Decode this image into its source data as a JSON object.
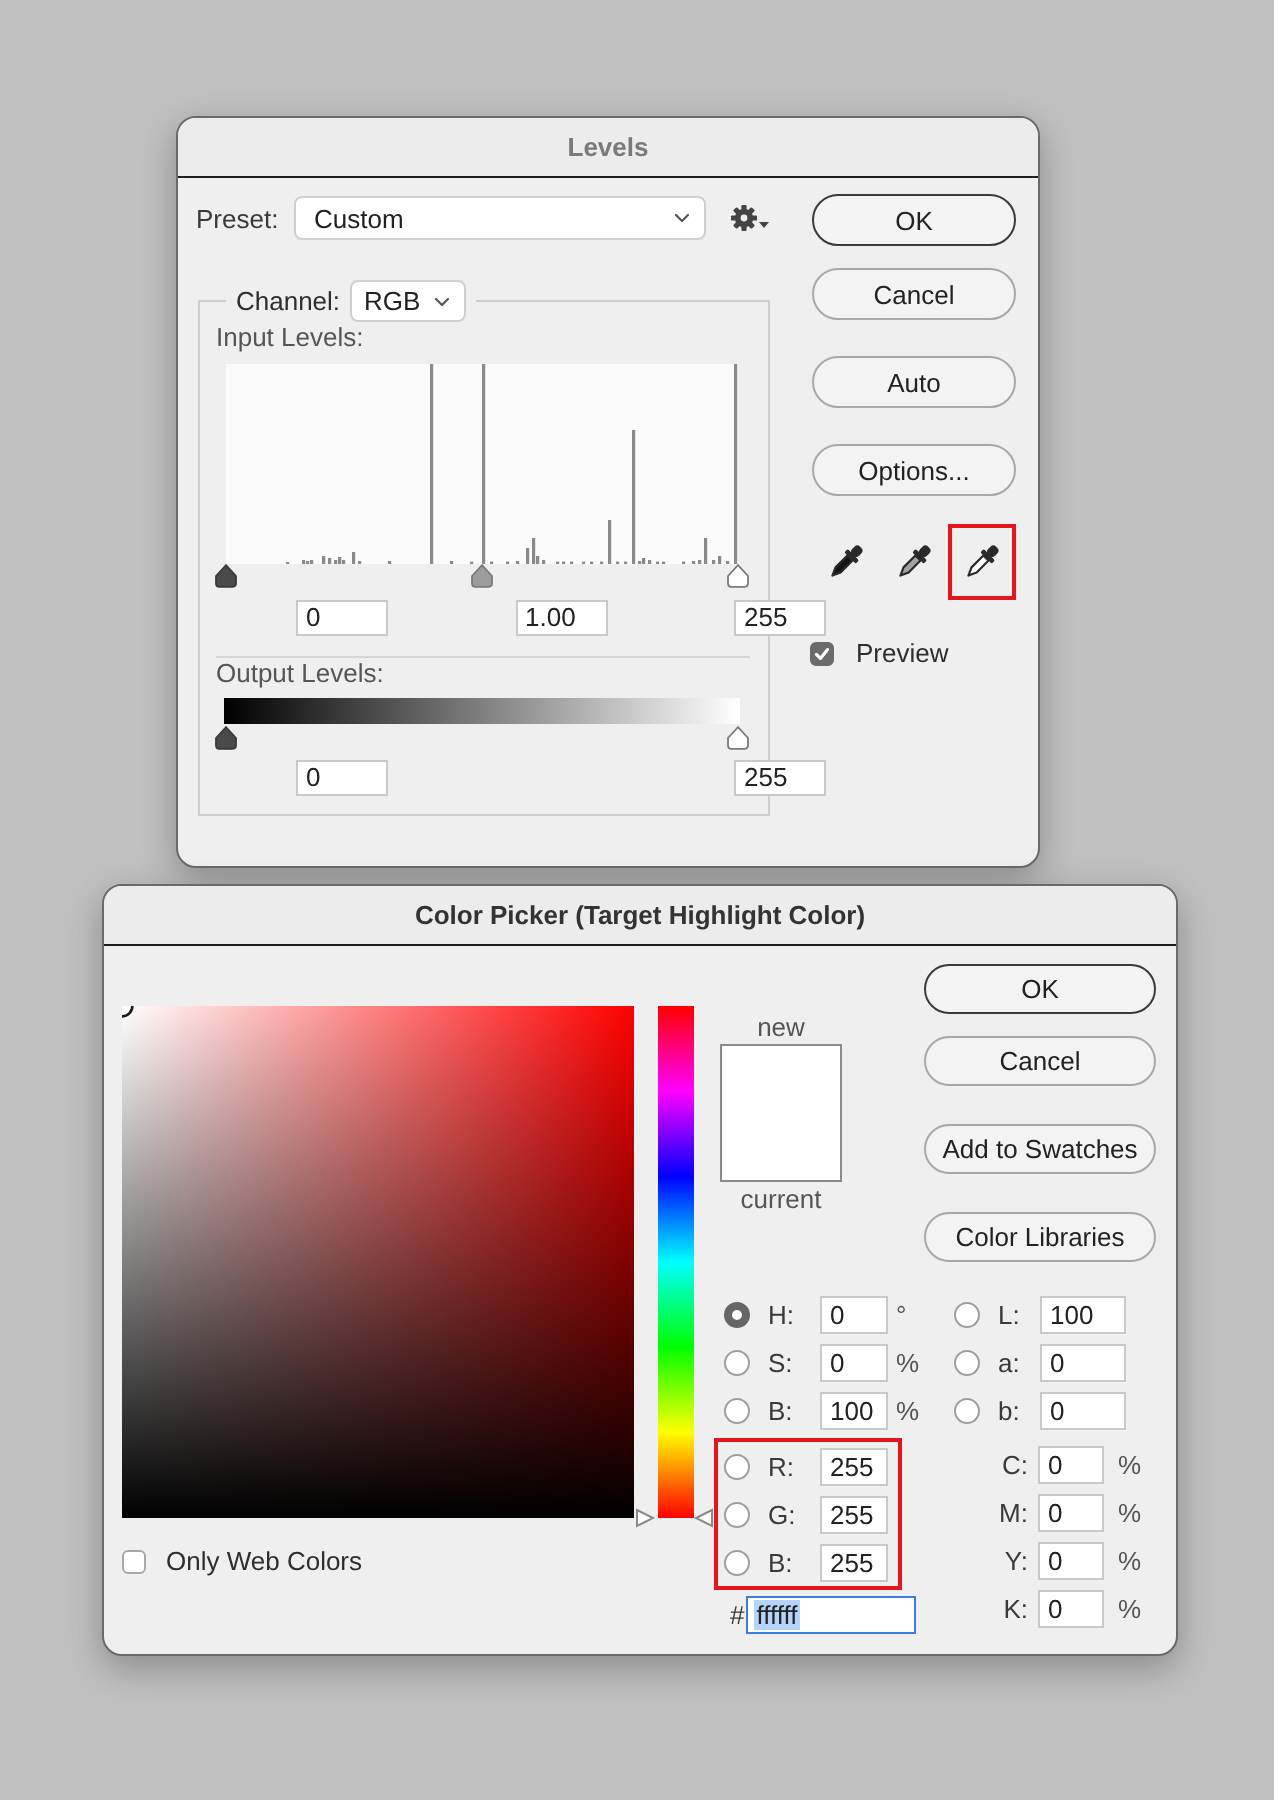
{
  "levels": {
    "title": "Levels",
    "active": false,
    "preset": {
      "label": "Preset:",
      "value": "Custom"
    },
    "channel": {
      "label": "Channel:",
      "value": "RGB"
    },
    "input_levels": {
      "label": "Input Levels:",
      "handles": [
        {
          "kind": "shadow",
          "level": 0
        },
        {
          "kind": "midtone",
          "level": 0.5
        },
        {
          "kind": "highlight",
          "level": 1
        }
      ],
      "fields": [
        "0",
        "1.00",
        "255"
      ]
    },
    "output_levels": {
      "label": "Output Levels:",
      "handles": [
        {
          "kind": "shadow",
          "level": 0
        },
        {
          "kind": "highlight",
          "level": 1
        }
      ],
      "fields": [
        "0",
        "255"
      ]
    },
    "buttons": [
      {
        "label": "OK",
        "default": true
      },
      {
        "label": "Cancel",
        "default": false
      },
      {
        "label": "Auto",
        "default": false
      },
      {
        "label": "Options...",
        "default": false
      }
    ],
    "eyedroppers": [
      {
        "kind": "black",
        "highlighted": false
      },
      {
        "kind": "gray",
        "highlighted": false
      },
      {
        "kind": "white",
        "highlighted": true
      }
    ],
    "preview": {
      "label": "Preview",
      "checked": true
    }
  },
  "color_picker": {
    "title": "Color Picker (Target Highlight Color)",
    "active": true,
    "hue_slider": {
      "level": 0
    },
    "swatches": [
      {
        "label": "new",
        "color": "#ffffff"
      },
      {
        "label": "current",
        "color": "#ffffff"
      }
    ],
    "buttons": [
      {
        "label": "OK",
        "default": true
      },
      {
        "label": "Cancel",
        "default": false
      },
      {
        "label": "Add to Swatches",
        "default": false
      },
      {
        "label": "Color Libraries",
        "default": false
      }
    ],
    "only_web_colors": {
      "label": "Only Web Colors",
      "checked": false
    },
    "hsb": [
      {
        "label": "H:",
        "value": "0",
        "unit": "°",
        "selected": true
      },
      {
        "label": "S:",
        "value": "0",
        "unit": "%",
        "selected": false
      },
      {
        "label": "B:",
        "value": "100",
        "unit": "%",
        "selected": false
      }
    ],
    "rgb": {
      "highlighted": true,
      "fields": [
        {
          "label": "R:",
          "value": "255",
          "selected": false
        },
        {
          "label": "G:",
          "value": "255",
          "selected": false
        },
        {
          "label": "B:",
          "value": "255",
          "selected": false
        }
      ]
    },
    "hex": {
      "label": "#",
      "value": "ffffff",
      "focused": true,
      "text_selected": true
    },
    "lab": [
      {
        "label": "L:",
        "value": "100",
        "selected": false
      },
      {
        "label": "a:",
        "value": "0",
        "selected": false
      },
      {
        "label": "b:",
        "value": "0",
        "selected": false
      }
    ],
    "cmyk": [
      {
        "label": "C:",
        "value": "0",
        "unit": "%"
      },
      {
        "label": "M:",
        "value": "0",
        "unit": "%"
      },
      {
        "label": "Y:",
        "value": "0",
        "unit": "%"
      },
      {
        "label": "K:",
        "value": "0",
        "unit": "%"
      }
    ]
  }
}
